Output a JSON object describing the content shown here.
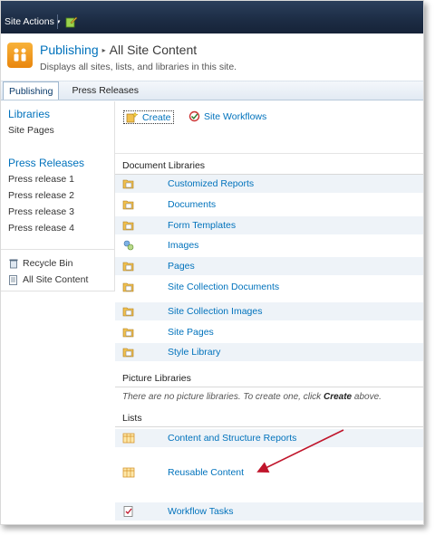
{
  "topbar": {
    "site_actions_label": "Site Actions",
    "caret": "▾"
  },
  "header": {
    "site_title": "Publishing",
    "breadcrumb_separator": "▸",
    "page_title": "All Site Content",
    "description": "Displays all sites, lists, and libraries in this site."
  },
  "topnav": {
    "tabs": [
      {
        "label": "Publishing",
        "active": true
      },
      {
        "label": "Press Releases",
        "active": false
      }
    ]
  },
  "leftnav": {
    "libraries_header": "Libraries",
    "libraries": [
      "Site Pages"
    ],
    "press_header": "Press Releases",
    "press_items": [
      "Press release 1",
      "Press release 2",
      "Press release 3",
      "Press release 4"
    ],
    "utilities": [
      {
        "label": "Recycle Bin",
        "icon": "recycle-bin-icon"
      },
      {
        "label": "All Site Content",
        "icon": "all-content-icon"
      }
    ]
  },
  "toolbar": {
    "create_label": "Create",
    "workflows_label": "Site Workflows"
  },
  "sections": {
    "document_libraries": {
      "header": "Document Libraries",
      "items": [
        "Customized Reports",
        "Documents",
        "Form Templates",
        "Images",
        "Pages",
        "Site Collection Documents",
        "Site Collection Images",
        "Site Pages",
        "Style Library"
      ]
    },
    "picture_libraries": {
      "header": "Picture Libraries",
      "empty_prefix": "There are no picture libraries. To create one, click ",
      "empty_link": "Create",
      "empty_suffix": " above."
    },
    "lists": {
      "header": "Lists",
      "items": [
        "Content and Structure Reports",
        "Reusable Content",
        "Workflow Tasks"
      ]
    }
  },
  "colors": {
    "link": "#0072bc",
    "topbar": "#1c2c44",
    "row_alt": "#eef3f8",
    "annotation_arrow": "#c0152b"
  }
}
